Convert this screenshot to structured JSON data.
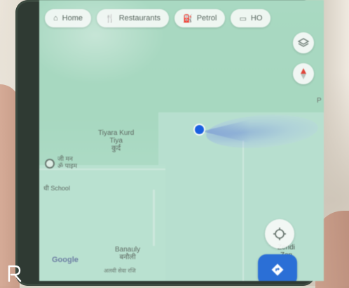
{
  "chips": [
    {
      "label": "Home",
      "icon": "home-icon"
    },
    {
      "label": "Restaurants",
      "icon": "fork-knife-icon"
    },
    {
      "label": "Petrol",
      "icon": "fuel-pump-icon"
    },
    {
      "label": "HO",
      "icon": "hotel-icon"
    }
  ],
  "map": {
    "place_tiyara": [
      "Tiyara Kurd",
      "Tiya",
      "कुर्द"
    ],
    "place_banauly": [
      "Banauly",
      "बनौली"
    ],
    "place_zendi": [
      "Zendi",
      "Zen"
    ],
    "poi_place": [
      "जी मन",
      "ॐ पाइम"
    ],
    "poi_school": "धी School",
    "edge_letter": "P",
    "google_logo": "Google",
    "bottom_text": "अलवी सेवा रजि"
  },
  "colors": {
    "map_green": "#a9d9c2",
    "location_blue": "#1a5fe0",
    "nav_button": "#2b6fd6"
  }
}
